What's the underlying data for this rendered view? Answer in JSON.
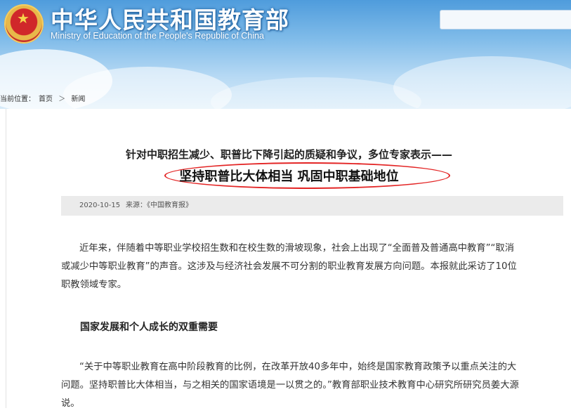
{
  "header": {
    "title_cn": "中华人民共和国教育部",
    "title_en": "Ministry of Education of the People's Republic of China"
  },
  "breadcrumb": {
    "prefix": "当前位置：",
    "items": [
      "首页",
      "新闻"
    ],
    "separator": "＞"
  },
  "article": {
    "sub_headline": "针对中职招生减少、职普比下降引起的质疑和争议，多位专家表示——",
    "headline": "坚持职普比大体相当 巩固中职基础地位",
    "date": "2020-10-15",
    "source": "来源：《中国教育报》",
    "paragraphs": [
      [
        "近年来，伴随着中等职业学校招生数和在校生数的滑坡现象，社会上出现了“全面普及普通高中教育”“取消",
        "或减少中等职业教育”的声音。这涉及与经济社会发展不可分割的职业教育发展方向问题。本报就此采访了10位",
        "职教领域专家。"
      ],
      [
        "“关于中等职业教育在高中阶段教育的比例，在改革开放40多年中，始终是国家教育政策予以重点关注的大",
        "问题。坚持职普比大体相当，与之相关的国家语境是一以贯之的。”教育部职业技术教育中心研究所研究员姜大源",
        "说。"
      ]
    ],
    "section_title": "国家发展和个人成长的双重需要"
  },
  "colors": {
    "banner_top": "#4f9cdc",
    "highlight_ellipse": "#e32424",
    "meta_bar_bg": "#ebebeb"
  },
  "icons": [
    "national-emblem-icon"
  ]
}
